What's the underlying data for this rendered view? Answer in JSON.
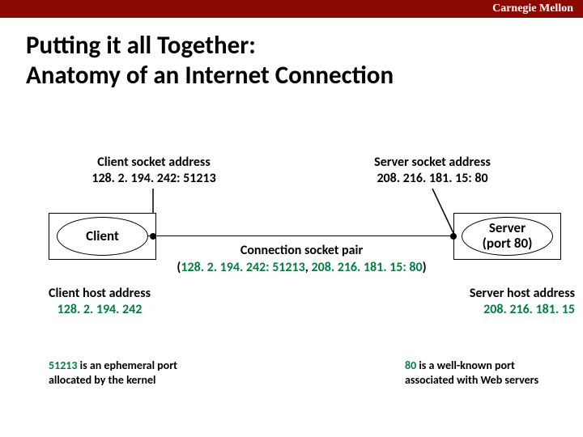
{
  "brand": "Carnegie Mellon",
  "title_line1": "Putting it all Together:",
  "title_line2": "Anatomy of an Internet Connection",
  "client_socket": {
    "label": "Client socket address",
    "value": "128. 2. 194. 242: 51213"
  },
  "server_socket": {
    "label": "Server socket address",
    "value": "208. 216. 181. 15: 80"
  },
  "client_node": "Client",
  "server_node_line1": "Server",
  "server_node_line2": "(port 80)",
  "connection": {
    "label": "Connection socket pair",
    "client_part": "128. 2. 194. 242: 51213",
    "server_part": "208. 216. 181. 15: 80"
  },
  "client_host": {
    "label": "Client host address",
    "value": "128. 2. 194. 242"
  },
  "server_host": {
    "label": "Server host address",
    "value": "208. 216. 181. 15"
  },
  "client_note": {
    "port": "51213",
    "rest1": " is an ephemeral port",
    "rest2": "allocated by the kernel"
  },
  "server_note": {
    "port": "80",
    "rest1": " is a well-known port",
    "rest2": "associated with Web servers"
  }
}
